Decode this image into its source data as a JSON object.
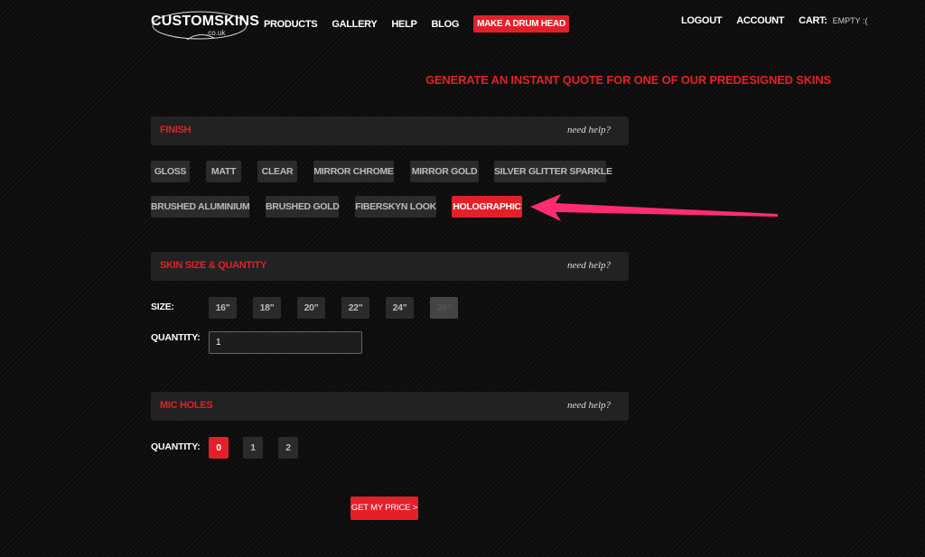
{
  "header": {
    "logo": {
      "text": "CUSTOMSKINS",
      "subtext": ".co.uk"
    },
    "nav": [
      "PRODUCTS",
      "GALLERY",
      "HELP",
      "BLOG"
    ],
    "cta": "MAKE A DRUM HEAD",
    "logout": "LOGOUT",
    "account": "ACCOUNT",
    "cart_label": "CART:",
    "cart_status": "EMPTY :("
  },
  "headline": "GENERATE AN INSTANT QUOTE FOR ONE OF OUR PREDESIGNED SKINS",
  "help_text": "need help?",
  "finish": {
    "title": "FINISH",
    "row1": [
      "GLOSS",
      "MATT",
      "CLEAR",
      "MIRROR CHROME",
      "MIRROR GOLD",
      "SILVER GLITTER SPARKLE"
    ],
    "row2": [
      "BRUSHED ALUMINIUM",
      "BRUSHED GOLD",
      "FIBERSKYN LOOK",
      "HOLOGRAPHIC"
    ],
    "selected": "HOLOGRAPHIC"
  },
  "size_qty": {
    "title": "SKIN SIZE & QUANTITY",
    "size_label": "SIZE:",
    "sizes": [
      "16\"",
      "18\"",
      "20\"",
      "22\"",
      "24\"",
      "26\""
    ],
    "disabled_size": "26\"",
    "quantity_label": "QUANTITY:",
    "quantity_value": "1"
  },
  "mic_holes": {
    "title": "MIC HOLES",
    "quantity_label": "QUANTITY:",
    "options": [
      "0",
      "1",
      "2"
    ],
    "selected": "0"
  },
  "price_button": "GET MY PRICE >",
  "colors": {
    "accent": "#e3202a",
    "arrow": "#ff2d6f",
    "panel": "#222222",
    "button": "#2b2b2b"
  }
}
